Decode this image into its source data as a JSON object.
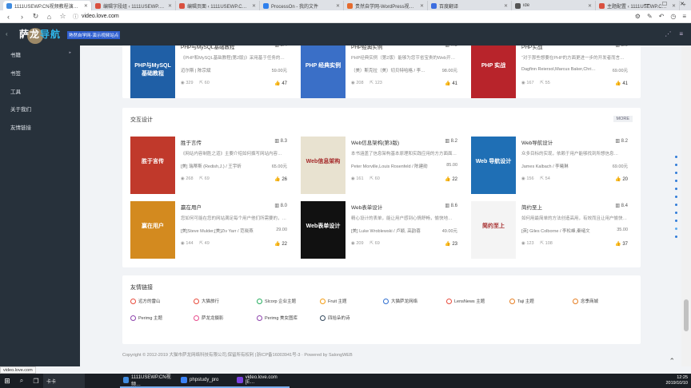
{
  "tabs": [
    {
      "title": "1111USEWP.CN视频教程演示网站",
      "color": "#3f8be0",
      "active": true
    },
    {
      "title": "编辑字段组 ‹ 1111USEWP.CN视频…",
      "color": "#d9503f",
      "active": false
    },
    {
      "title": "编辑页面 ‹ 1111USEWP.CN视频…",
      "color": "#d9503f",
      "active": false
    },
    {
      "title": "ProcessOn - 我的文件",
      "color": "#2f80ed",
      "active": false
    },
    {
      "title": "贵然自学网-WordPress视频教程…",
      "color": "#e56b2e",
      "active": false
    },
    {
      "title": "百度翻译",
      "color": "#3c6de0",
      "active": false
    },
    {
      "title": "ide",
      "color": "#555",
      "active": false
    },
    {
      "title": "主题配置 ‹ 1111USEWP.CN视频…",
      "color": "#d9503f",
      "active": false
    }
  ],
  "address": {
    "url": "video.love.com"
  },
  "header": {
    "logo_main": "萨龙",
    "logo_accent": "导航",
    "badge": "熟然自学网-演示视频站点"
  },
  "sidebar": {
    "items": [
      {
        "label": "书籍",
        "has_children": true
      },
      {
        "label": "书签"
      },
      {
        "label": "工具"
      },
      {
        "label": "关于我们"
      },
      {
        "label": "友情链接"
      }
    ]
  },
  "sections": [
    {
      "title": "",
      "books": [
        {
          "title": "PHP与MySQL基础教程",
          "rating": "8.4",
          "desc": "《PHP和MySQL基础教程(第2版)》采用基于任务的…",
          "author": "迈尔斯 | 陈宗斌",
          "price": "59.00元",
          "views": "329",
          "shares": "60",
          "likes": "47",
          "cover_color": "#1f5fa6",
          "cover_text": "PHP与MySQL 基础教程"
        },
        {
          "title": "PHP经典实例",
          "rating": "7.9",
          "desc": "PHP经典实例（第2版）能够为您节省宝贵的Web开…",
          "author": "（美）斯克拉（美）切贝特哈格 / 李…",
          "price": "98.00元",
          "views": "208",
          "shares": "123",
          "likes": "41",
          "cover_color": "#3a6fc7",
          "cover_text": "PHP 经典实例"
        },
        {
          "title": "PHP实战",
          "rating": "8.0",
          "desc": "“对于那些想要在PHP的方面更进一步的开发者而言…",
          "author": "Dagfinn Reiersol,Marcus Baker,Chri…",
          "price": "69.00元",
          "views": "167",
          "shares": "55",
          "likes": "41",
          "cover_color": "#b8242b",
          "cover_text": "PHP 实战"
        }
      ]
    },
    {
      "title": "交互设计",
      "more": "MORE",
      "books": [
        {
          "title": "胜于言传",
          "rating": "8.3",
          "desc": "《网站内容制胜之道》主要介绍如何撰写网站内容…",
          "author": "[美] 瑞蒂斯 (Redish,J.) / 王宇昕",
          "price": "65.00元",
          "views": "268",
          "shares": "69",
          "likes": "26",
          "cover_color": "#c0392b",
          "cover_text": "胜于言传"
        },
        {
          "title": "Web信息架构(第3版)",
          "rating": "8.2",
          "desc": "本书涵盖了信息架构基本原理和实践应用的方方面面…",
          "author": "Peter Morville,Louis Rosenfeld / 陈建勋",
          "price": "85.00",
          "views": "161",
          "shares": "60",
          "likes": "22",
          "cover_color": "#e8e2d0",
          "cover_text": "Web信息架构"
        },
        {
          "title": "Web导航设计",
          "rating": "8.2",
          "desc": "众多目标的实现，依赖于用户能够找到所想信息…",
          "author": "James Kalbach / 李曦琳",
          "price": "69.00元",
          "views": "156",
          "shares": "54",
          "likes": "20",
          "cover_color": "#1f6fb5",
          "cover_text": "Web 导航设计"
        },
        {
          "title": "赢在用户",
          "rating": "8.0",
          "desc": "您如何可能在您的网站满足每个用户他们所需要的，并…",
          "author": "[美]Steve Mulder,[美]Ziv Yarr / 范晓燕",
          "price": "29.00",
          "views": "144",
          "shares": "49",
          "likes": "22",
          "cover_color": "#d38a1f",
          "cover_text": "赢在用户"
        },
        {
          "title": "Web表单设计",
          "rating": "8.6",
          "desc": "精心设计的表单，能让用户感到心情舒畅，愉快地…",
          "author": "[美] Luke Wroblewski / 卢颖, 高韵蓓",
          "price": "49.00元",
          "views": "209",
          "shares": "69",
          "likes": "23",
          "cover_color": "#111",
          "cover_text": "Web表单设计"
        },
        {
          "title": "简约至上",
          "rating": "8.4",
          "desc": "如何用最简单的方法创造高用，有效而且让用户愉快…",
          "author": "[英] Giles Colborne / 李松峰,秦绪文",
          "price": "35.00",
          "views": "123",
          "shares": "108",
          "likes": "37",
          "cover_color": "#f4f4f4",
          "cover_text": "简约至上"
        }
      ]
    }
  ],
  "friends": {
    "title": "友情链接",
    "links": [
      {
        "label": "远方的雷山",
        "color": "#e84c3d"
      },
      {
        "label": "大猫旅行",
        "color": "#e84c3d"
      },
      {
        "label": "Slcorp 企业主题",
        "color": "#27ae60"
      },
      {
        "label": "Fruit 主题",
        "color": "#f39c12"
      },
      {
        "label": "大猫萨龙网络",
        "color": "#2f6fd0"
      },
      {
        "label": "LensNews 主题",
        "color": "#e84c3d"
      },
      {
        "label": "Taji 主题",
        "color": "#e67e22"
      },
      {
        "label": "念季商城",
        "color": "#e67e22"
      },
      {
        "label": "Perimg 主题",
        "color": "#8e44ad"
      },
      {
        "label": "萨龙龙摄影",
        "color": "#e84c8d"
      },
      {
        "label": "Perimg 美女图库",
        "color": "#8e44ad"
      },
      {
        "label": "四拾朵的诗",
        "color": "#34495e"
      }
    ]
  },
  "footer": {
    "copyright": "Copyright © 2012-2019 大猫市萨龙网络科技有限公司,保留所有权利 |浙ICP备16003941号-3 · Powered by SalongWEB"
  },
  "status_url": "video.love.com",
  "taskbar": {
    "search": "卡卡",
    "apps": [
      {
        "label": "1111USEWP.CN视频…",
        "color": "#3f8be0"
      },
      {
        "label": "phpstudy_pro",
        "color": "#3b82f6"
      },
      {
        "label": "video.love.com [E…",
        "color": "#7b3fe0"
      }
    ],
    "time": "12:25",
    "date": "2019/10/10"
  }
}
